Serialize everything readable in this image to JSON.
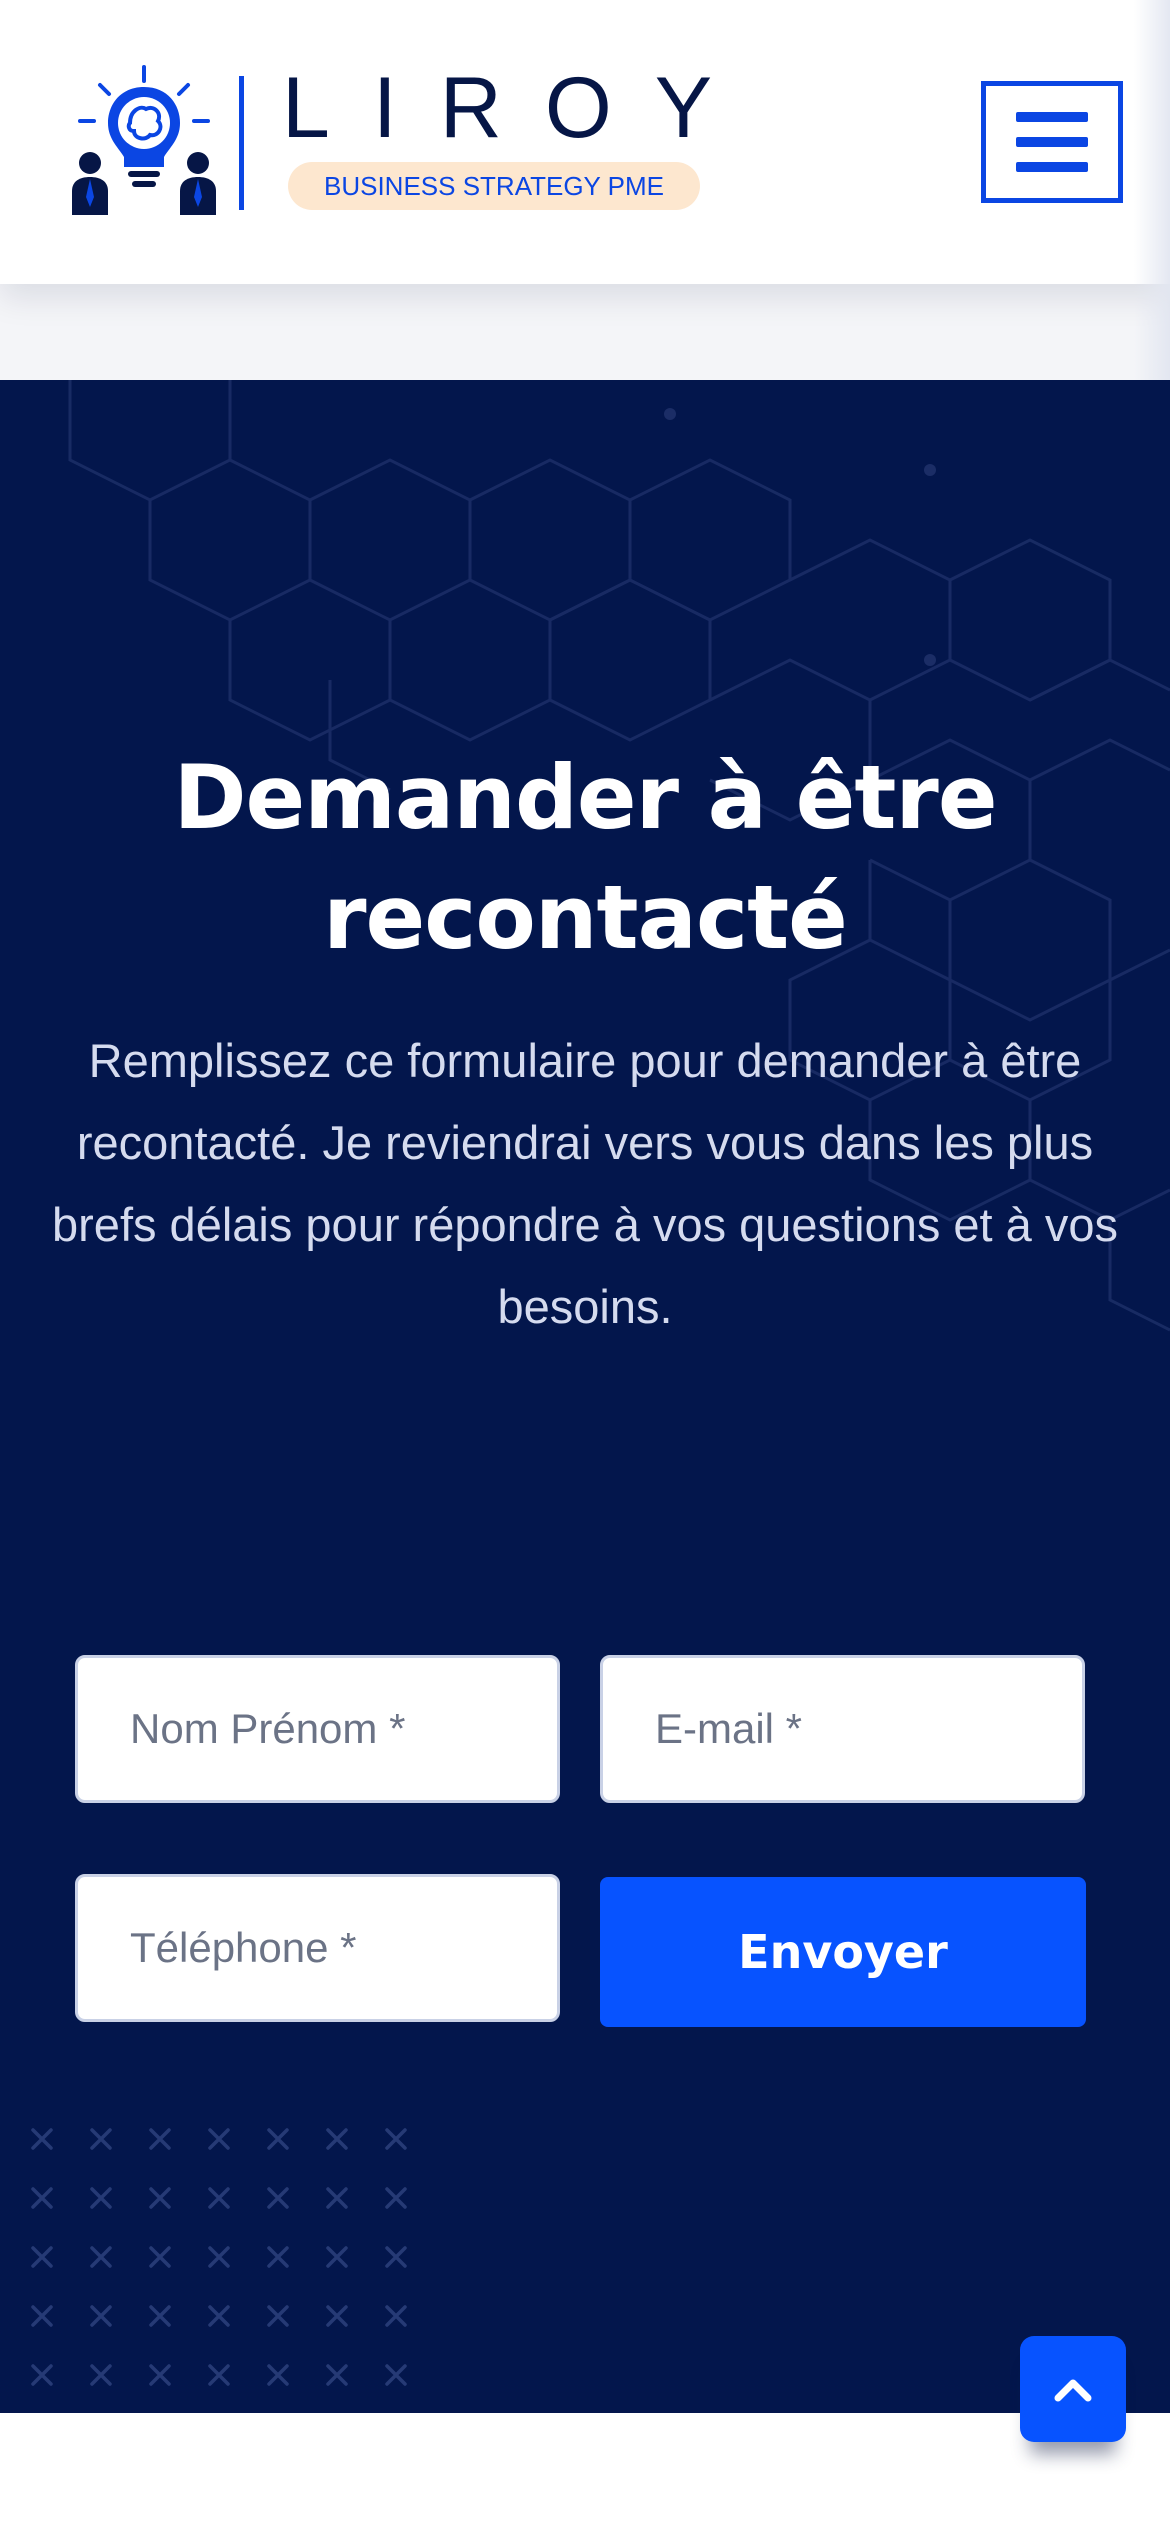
{
  "header": {
    "logo_word": "LIROY",
    "logo_tagline": "BUSINESS STRATEGY PME",
    "menu_icon": "hamburger-icon"
  },
  "contact": {
    "title": "Demander à être recontacté",
    "description": "Remplissez ce formulaire pour demander à être recontacté. Je reviendrai vers vous dans les plus brefs délais pour répondre à vos questions et à vos besoins.",
    "fields": {
      "name_placeholder": "Nom Prénom *",
      "email_placeholder": "E-mail *",
      "phone_placeholder": "Téléphone *"
    },
    "submit_label": "Envoyer"
  },
  "scroll_top_icon": "chevron-up-icon",
  "colors": {
    "brand_blue": "#0753ff",
    "navy": "#03164c",
    "logo_dark": "#061646",
    "tag_bg": "#fde7cf"
  }
}
